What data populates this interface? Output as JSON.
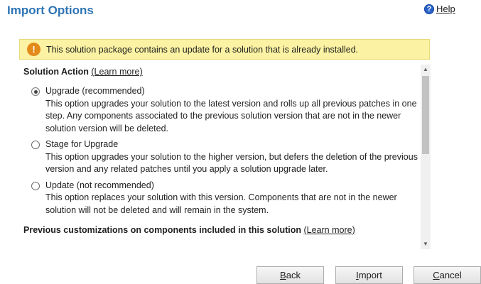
{
  "dialog": {
    "title": "Import Options",
    "help_label": "Help"
  },
  "notice": {
    "text": "This solution package contains an update for a solution that is already installed."
  },
  "solution_action": {
    "heading": "Solution Action",
    "link": "(Learn more)",
    "selected": "upgrade",
    "options": [
      {
        "label": "Upgrade (recommended)",
        "description": "This option upgrades your solution to the latest version and rolls up all previous patches in one step. Any components associated to the previous solution version that are not in the newer solution version will be deleted."
      },
      {
        "label": "Stage for Upgrade",
        "description": "This option upgrades your solution to the higher version, but defers the deletion of the previous version and any related patches until you apply a solution upgrade later."
      },
      {
        "label": "Update (not recommended)",
        "description": "This option replaces your solution with this version. Components that are not in the newer solution will not be deleted and will remain in the system."
      }
    ]
  },
  "previous_customizations": {
    "heading": "Previous customizations on components included in this solution",
    "link": "(Learn more)"
  },
  "buttons": {
    "back_mnemonic": "B",
    "back_rest": "ack",
    "import_mnemonic": "I",
    "import_rest": "mport",
    "cancel_mnemonic": "C",
    "cancel_rest": "ancel"
  }
}
